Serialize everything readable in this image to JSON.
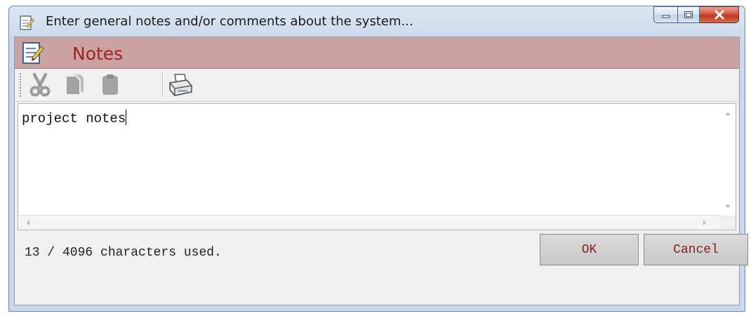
{
  "window": {
    "title": "Enter general notes and/or comments about the system...",
    "icon": "notes-doc-icon"
  },
  "title_buttons": {
    "minimize_icon": "minimize-icon",
    "maximize_icon": "maximize-icon",
    "close_icon": "close-icon"
  },
  "header": {
    "title": "Notes",
    "icon": "notes-doc-icon",
    "bg_color": "#caa29f",
    "title_color": "#a0202a"
  },
  "toolbar": {
    "items": [
      {
        "name": "cut",
        "icon": "scissors-icon",
        "enabled": false
      },
      {
        "name": "copy",
        "icon": "copy-icon",
        "enabled": false
      },
      {
        "name": "paste",
        "icon": "paste-icon",
        "enabled": false
      },
      {
        "name": "print",
        "icon": "printer-icon",
        "enabled": true
      }
    ]
  },
  "editor": {
    "value": "project notes"
  },
  "status": {
    "text": "13 / 4096 characters used."
  },
  "buttons": {
    "ok_label": "OK",
    "cancel_label": "Cancel"
  }
}
